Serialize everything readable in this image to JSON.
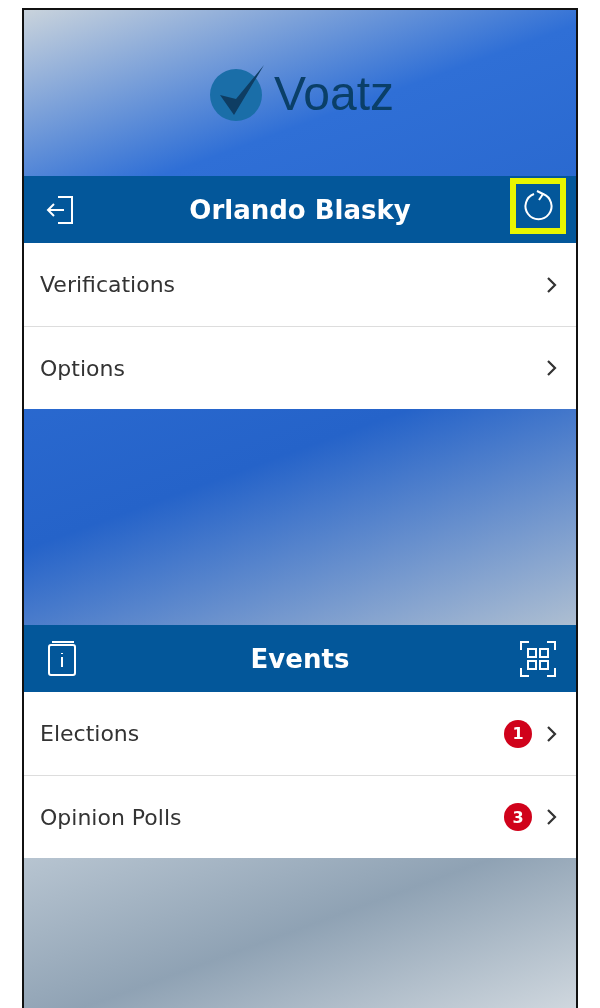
{
  "logo": {
    "text": "Voatz"
  },
  "account_bar": {
    "title": "Orlando Blasky",
    "refresh_highlighted": true
  },
  "account_menu": [
    {
      "label": "Verifications"
    },
    {
      "label": "Options"
    }
  ],
  "events_bar": {
    "title": "Events"
  },
  "events_menu": [
    {
      "label": "Elections",
      "badge": "1"
    },
    {
      "label": "Opinion Polls",
      "badge": "3"
    }
  ]
}
